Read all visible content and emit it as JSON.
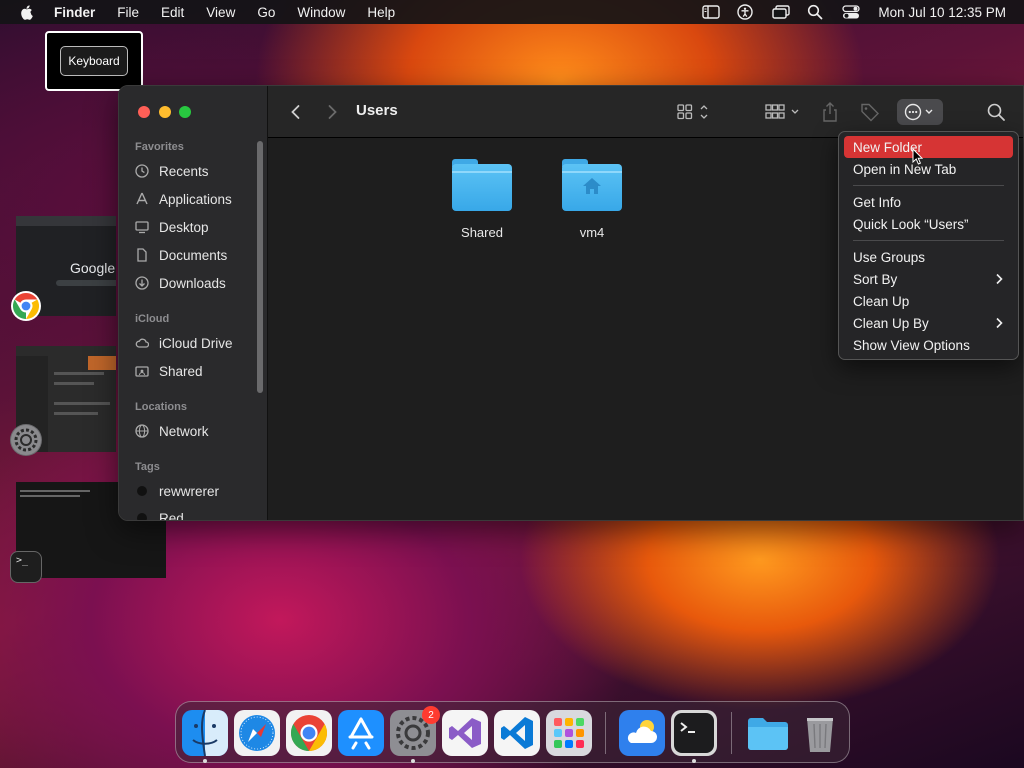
{
  "menubar": {
    "app_name": "Finder",
    "items": [
      "File",
      "Edit",
      "View",
      "Go",
      "Window",
      "Help"
    ],
    "clock": "Mon Jul 10  12:35 PM"
  },
  "keyboard_badge": "Keyboard",
  "switcher": {
    "google_text": "Google",
    "terminal_prompt": ">_"
  },
  "finder": {
    "title": "Users",
    "sidebar": {
      "favorites_header": "Favorites",
      "favorites": [
        "Recents",
        "Applications",
        "Desktop",
        "Documents",
        "Downloads"
      ],
      "icloud_header": "iCloud",
      "icloud": [
        "iCloud Drive",
        "Shared"
      ],
      "locations_header": "Locations",
      "locations": [
        "Network"
      ],
      "tags_header": "Tags",
      "tags": [
        "rewwrerer",
        "Red"
      ]
    },
    "items": [
      {
        "name": "Shared"
      },
      {
        "name": "vm4"
      }
    ]
  },
  "context_menu": {
    "items": [
      "New Folder",
      "Open in New Tab",
      "Get Info",
      "Quick Look “Users”",
      "Use Groups",
      "Sort By",
      "Clean Up",
      "Clean Up By",
      "Show View Options"
    ],
    "highlighted": "New Folder"
  },
  "dock": {
    "apps": [
      "finder-icon",
      "safari-icon",
      "chrome-icon",
      "app-store-icon",
      "system-settings-icon",
      "visual-studio-icon",
      "vscode-icon",
      "launchpad-icon",
      "weather-icon",
      "terminal-icon",
      "folder-icon",
      "trash-icon"
    ],
    "settings_badge": "2"
  },
  "colors": {
    "menu_highlight": "#d63434",
    "folder_blue": "#4cb8f0",
    "close": "#ff5f57",
    "minimize": "#febc2e",
    "maximize": "#28c840"
  }
}
